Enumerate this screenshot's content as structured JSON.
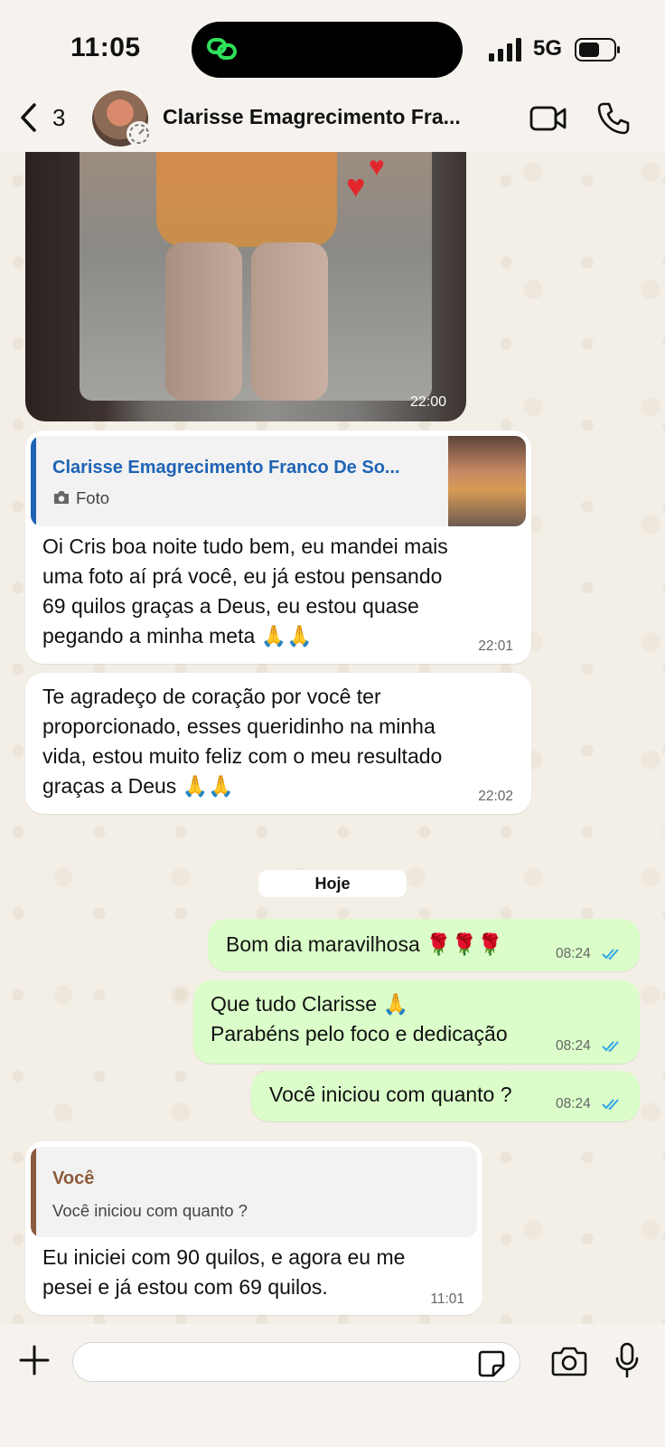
{
  "status_bar": {
    "time": "11:05",
    "network": "5G"
  },
  "header": {
    "back_count": "3",
    "contact_name": "Clarisse Emagrecimento Fra..."
  },
  "messages": {
    "photo": {
      "time": "22:00"
    },
    "reply1": {
      "quote_author": "Clarisse Emagrecimento Franco De So...",
      "quote_type": "Foto",
      "text": "Oi Cris  boa noite tudo bem,  eu mandei  mais\numa foto aí  prá você,  eu já estou  pensando\n69 quilos  graças a Deus,  eu estou quase\npegando  a minha  meta 🙏🙏",
      "time": "22:01"
    },
    "msg2": {
      "text": "Te agradeço de coração por você ter\nproporcionado, esses queridinho  na minha\nvida, estou muito  feliz com o meu resultado\ngraças a Deus 🙏🙏",
      "time": "22:02"
    },
    "day_separator": "Hoje",
    "out1": {
      "text": "Bom dia maravilhosa 🌹🌹🌹",
      "time": "08:24"
    },
    "out2": {
      "text": "Que tudo Clarisse 🙏\nParabéns pelo foco e dedicação",
      "time": "08:24"
    },
    "out3": {
      "text": "Você iniciou com quanto ?",
      "time": "08:24"
    },
    "reply2": {
      "quote_author": "Você",
      "quote_text": "Você iniciou com quanto ?",
      "text": "Eu iniciei  com 90 quilos, e agora  eu me\npesei e já estou com 69 quilos.",
      "time": "11:01"
    }
  },
  "composer": {
    "value": ""
  },
  "colors": {
    "outgoing_bubble": "#dafdc9",
    "incoming_bubble": "#ffffff",
    "read_ticks": "#34a5e8",
    "quote_bar_contact": "#1e63b5",
    "quote_bar_self": "#8b5a3c"
  }
}
